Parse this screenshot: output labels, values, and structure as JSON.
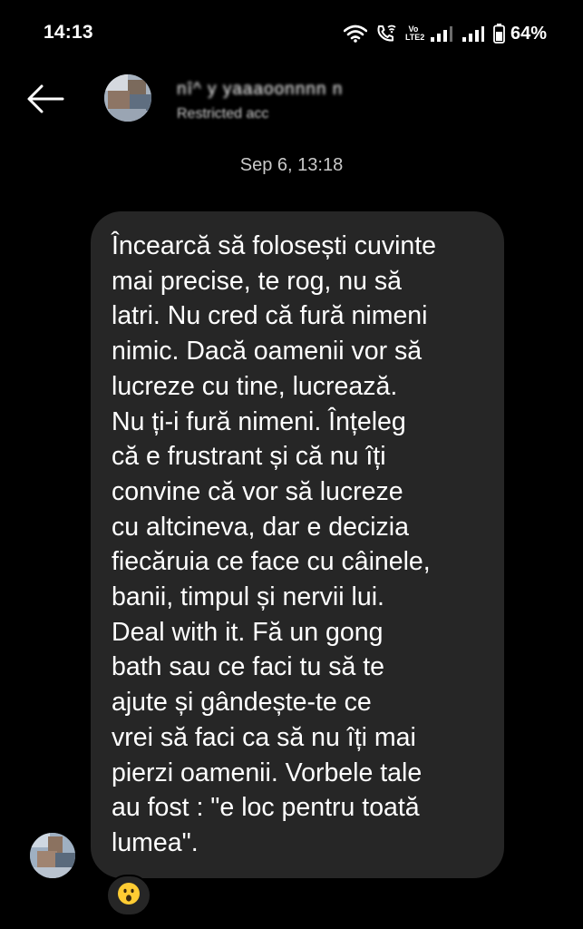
{
  "status_bar": {
    "time": "14:13",
    "battery_percent": "64%",
    "icons": [
      "wifi-icon",
      "wifi-call-icon",
      "volte-icon",
      "signal-icon",
      "signal-icon",
      "battery-icon"
    ],
    "volte_top": "Vo",
    "volte_bottom": "LTE2"
  },
  "header": {
    "back_icon": "arrow-left-icon",
    "contact_name": "nî^ y yaaaoonnnn  n",
    "contact_subtitle": "Restricted acc"
  },
  "conversation": {
    "timestamp": "Sep 6, 13:18",
    "messages": [
      {
        "direction": "incoming",
        "text": "Încearcă să folosești cuvinte\nmai precise, te rog, nu să\nlatri. Nu cred că fură nimeni\nnimic. Dacă oamenii vor să\nlucreze cu tine, lucrează.\nNu ți-i fură nimeni. Înțeleg\ncă e frustrant și că nu îți\nconvine că vor să lucreze\ncu altcineva, dar e decizia\nfiecăruia ce face cu câinele,\nbanii, timpul și nervii lui.\nDeal with it. Fă un gong\nbath sau ce faci tu să te\najute și gândește-te ce\nvrei să faci ca să nu îți mai\npierzi oamenii. Vorbele tale\nau fost : \"e loc pentru toată\nlumea\".",
        "reaction": "😮"
      }
    ]
  },
  "colors": {
    "background": "#000000",
    "bubble": "#262626",
    "text": "#ffffff",
    "timestamp": "#c9c9c9"
  }
}
